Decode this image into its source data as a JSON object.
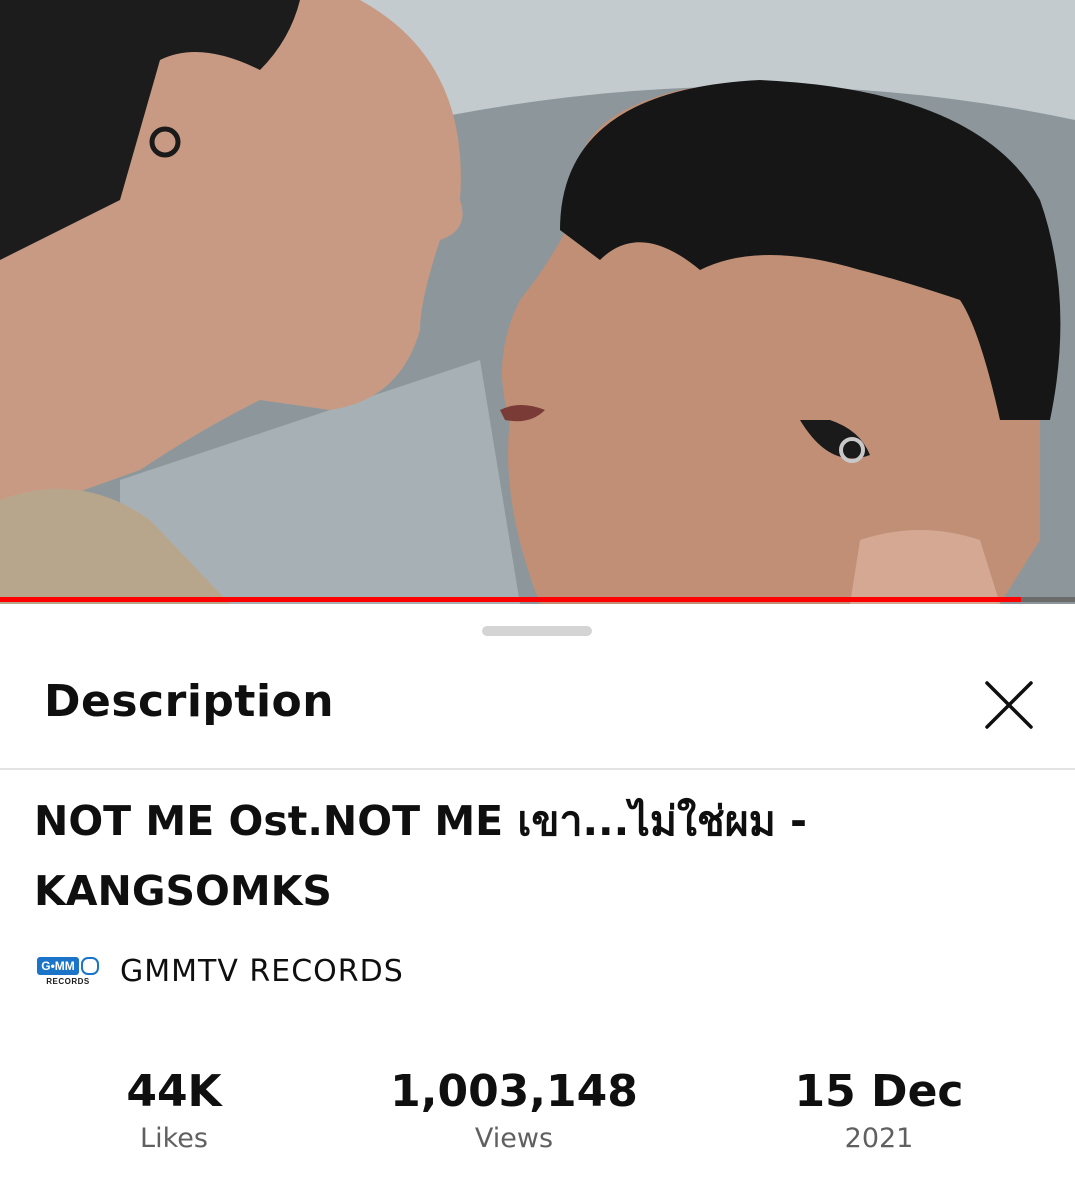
{
  "video": {
    "progress_fraction": 0.95
  },
  "sheet": {
    "title": "Description"
  },
  "video_title": "NOT ME Ost.NOT ME เขา...ไม่ใช่ผม - KANGSOMKS",
  "channel": {
    "name": "GMMTV RECORDS",
    "logo_text": "G•MM",
    "logo_sub": "RECORDS"
  },
  "stats": {
    "likes_value": "44K",
    "likes_label": "Likes",
    "views_value": "1,003,148",
    "views_label": "Views",
    "date_value": "15 Dec",
    "date_label": "2021"
  },
  "colors": {
    "progress": "#ff0000",
    "text_primary": "#0f0f0f",
    "text_secondary": "#606060"
  }
}
